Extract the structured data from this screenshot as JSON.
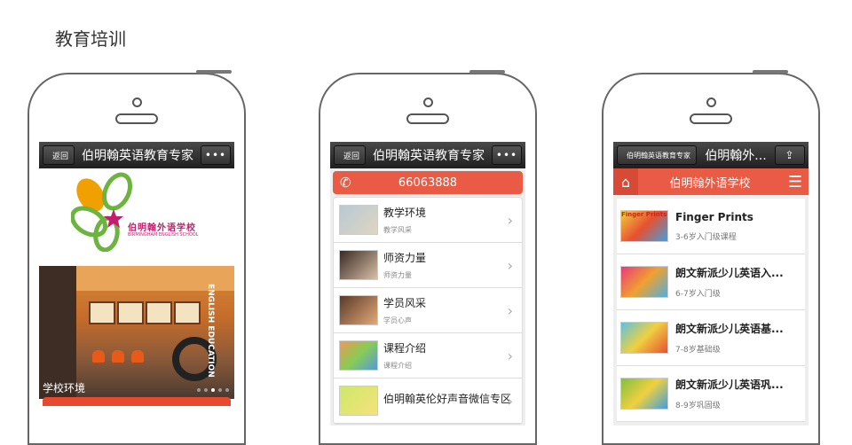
{
  "page": {
    "title": "教育培训"
  },
  "phone1": {
    "topbar": {
      "back_label": "返回",
      "title": "伯明翰英语教育专家",
      "more_label": "•••"
    },
    "logo": {
      "school_cn": "伯明翰外语学校",
      "school_en": "BIRMINGHAM ENGLISH SCHOOL"
    },
    "photo": {
      "caption": "学校环境",
      "wall_text": "ENGLISH EDUCATION",
      "slide_count": 5,
      "active_slide": 3
    }
  },
  "phone2": {
    "topbar": {
      "back_label": "返回",
      "title": "伯明翰英语教育专家",
      "more_label": "•••"
    },
    "phone_number": "66063888",
    "items": [
      {
        "title": "教学环境",
        "subtitle": "教学风采"
      },
      {
        "title": "师资力量",
        "subtitle": "师资力量"
      },
      {
        "title": "学员风采",
        "subtitle": "学员心声"
      },
      {
        "title": "课程介绍",
        "subtitle": "课程介绍"
      },
      {
        "title": "伯明翰英伦好声音微信专区",
        "subtitle": ""
      }
    ]
  },
  "phone3": {
    "topbar": {
      "back_label": "伯明翰英语教育专家",
      "title": "伯明翰外..."
    },
    "header": {
      "title": "伯明翰外语学校"
    },
    "courses": [
      {
        "title": "Finger Prints",
        "subtitle": "3-6岁入门级课程",
        "thumb_text": "Finger Prints"
      },
      {
        "title": "朗文新派少儿英语入...",
        "subtitle": "6-7岁入门级",
        "thumb_text": ""
      },
      {
        "title": "朗文新派少儿英语基...",
        "subtitle": "7-8岁基础级",
        "thumb_text": ""
      },
      {
        "title": "朗文新派少儿英语巩...",
        "subtitle": "8-9岁巩固级",
        "thumb_text": ""
      }
    ]
  },
  "colors": {
    "accent_red": "#e95b45",
    "bar_dark": "#2b2b2b"
  }
}
